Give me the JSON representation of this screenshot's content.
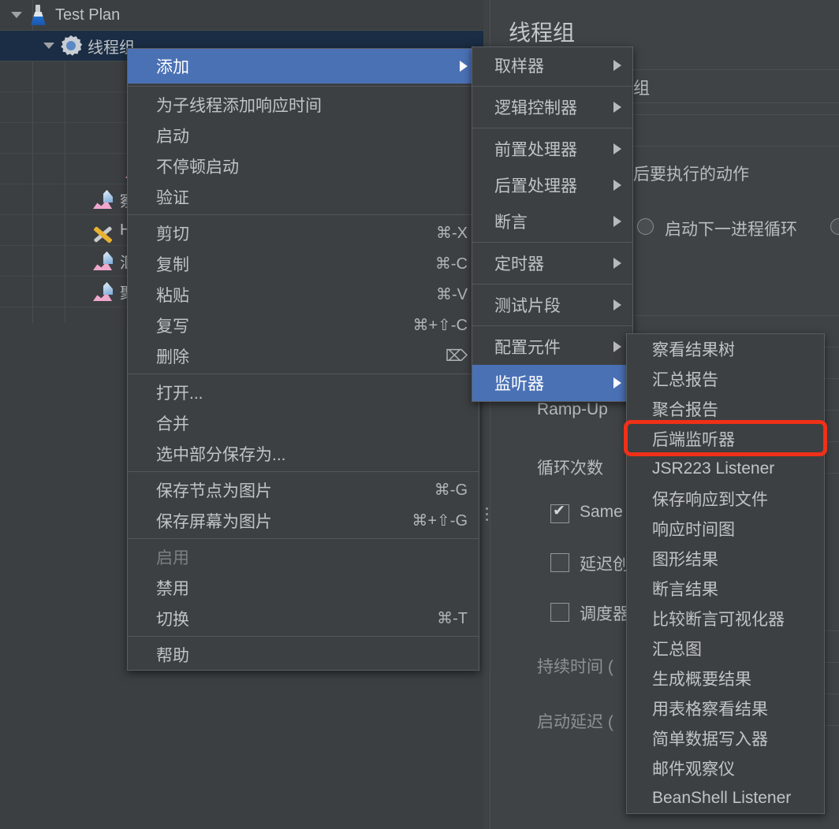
{
  "app": {
    "title": "线程组",
    "theme_bg": "#3c3f41",
    "menu_bg": "#3d4042",
    "highlight_blue": "#4b71b5",
    "selection_navy": "#1b2d44",
    "annotation_red": "#f03018"
  },
  "tree": {
    "items": [
      {
        "label": "Test Plan",
        "icon": "flask-icon",
        "depth": 0,
        "expanded": true,
        "selected": false
      },
      {
        "label": "线程组",
        "icon": "gear-icon",
        "depth": 1,
        "expanded": true,
        "selected": true
      },
      {
        "label": "",
        "icon": "pipette-green-icon",
        "depth": 3,
        "expanded": false,
        "selected": false
      },
      {
        "label": "",
        "icon": "pipette-gray-icon",
        "depth": 3,
        "expanded": false,
        "selected": false
      },
      {
        "label": "",
        "icon": "pipette-gray-icon",
        "depth": 3,
        "expanded": false,
        "selected": false
      },
      {
        "label": "",
        "icon": "chart-icon",
        "depth": 3,
        "expanded": false,
        "selected": false
      },
      {
        "label": "察看",
        "icon": "chart-icon",
        "depth": 2,
        "expanded": false,
        "selected": false
      },
      {
        "label": "HT",
        "icon": "tools-icon",
        "depth": 2,
        "expanded": false,
        "selected": false
      },
      {
        "label": "汇总",
        "icon": "chart-icon",
        "depth": 2,
        "expanded": false,
        "selected": false
      },
      {
        "label": "聚合",
        "icon": "chart-icon",
        "depth": 2,
        "expanded": false,
        "selected": false
      }
    ]
  },
  "form": {
    "title": "线程组",
    "name_fragment": "组",
    "action_label": "后要执行的动作",
    "radio_label": "启动下一进程循环",
    "ramp_up_label": "Ramp-Up",
    "loop_count_label": "循环次数",
    "same_user_label": "Same",
    "delay_create_label": "延迟创",
    "scheduler_label": "调度器",
    "duration_label": "持续时间 (",
    "startup_delay_label": "启动延迟 ("
  },
  "menu_context": {
    "items": [
      {
        "label": "添加",
        "accel": "",
        "submenu": true,
        "highlight": true,
        "disabled": false,
        "sep_after": true
      },
      {
        "label": "为子线程添加响应时间",
        "accel": "",
        "submenu": false,
        "highlight": false,
        "disabled": false,
        "sep_after": false
      },
      {
        "label": "启动",
        "accel": "",
        "submenu": false,
        "highlight": false,
        "disabled": false,
        "sep_after": false
      },
      {
        "label": "不停顿启动",
        "accel": "",
        "submenu": false,
        "highlight": false,
        "disabled": false,
        "sep_after": false
      },
      {
        "label": "验证",
        "accel": "",
        "submenu": false,
        "highlight": false,
        "disabled": false,
        "sep_after": true
      },
      {
        "label": "剪切",
        "accel": "⌘-X",
        "submenu": false,
        "highlight": false,
        "disabled": false,
        "sep_after": false
      },
      {
        "label": "复制",
        "accel": "⌘-C",
        "submenu": false,
        "highlight": false,
        "disabled": false,
        "sep_after": false
      },
      {
        "label": "粘贴",
        "accel": "⌘-V",
        "submenu": false,
        "highlight": false,
        "disabled": false,
        "sep_after": false
      },
      {
        "label": "复写",
        "accel": "⌘+⇧-C",
        "submenu": false,
        "highlight": false,
        "disabled": false,
        "sep_after": false
      },
      {
        "label": "删除",
        "accel": "⌦",
        "submenu": false,
        "highlight": false,
        "disabled": false,
        "sep_after": true
      },
      {
        "label": "打开...",
        "accel": "",
        "submenu": false,
        "highlight": false,
        "disabled": false,
        "sep_after": false
      },
      {
        "label": "合并",
        "accel": "",
        "submenu": false,
        "highlight": false,
        "disabled": false,
        "sep_after": false
      },
      {
        "label": "选中部分保存为...",
        "accel": "",
        "submenu": false,
        "highlight": false,
        "disabled": false,
        "sep_after": true
      },
      {
        "label": "保存节点为图片",
        "accel": "⌘-G",
        "submenu": false,
        "highlight": false,
        "disabled": false,
        "sep_after": false
      },
      {
        "label": "保存屏幕为图片",
        "accel": "⌘+⇧-G",
        "submenu": false,
        "highlight": false,
        "disabled": false,
        "sep_after": true
      },
      {
        "label": "启用",
        "accel": "",
        "submenu": false,
        "highlight": false,
        "disabled": true,
        "sep_after": false
      },
      {
        "label": "禁用",
        "accel": "",
        "submenu": false,
        "highlight": false,
        "disabled": false,
        "sep_after": false
      },
      {
        "label": "切换",
        "accel": "⌘-T",
        "submenu": false,
        "highlight": false,
        "disabled": false,
        "sep_after": true
      },
      {
        "label": "帮助",
        "accel": "",
        "submenu": false,
        "highlight": false,
        "disabled": false,
        "sep_after": false
      }
    ]
  },
  "menu_add": {
    "items": [
      {
        "label": "取样器",
        "submenu": true,
        "highlight": false,
        "sep_after": true
      },
      {
        "label": "逻辑控制器",
        "submenu": true,
        "highlight": false,
        "sep_after": true
      },
      {
        "label": "前置处理器",
        "submenu": true,
        "highlight": false,
        "sep_after": false
      },
      {
        "label": "后置处理器",
        "submenu": true,
        "highlight": false,
        "sep_after": false
      },
      {
        "label": "断言",
        "submenu": true,
        "highlight": false,
        "sep_after": true
      },
      {
        "label": "定时器",
        "submenu": true,
        "highlight": false,
        "sep_after": true
      },
      {
        "label": "测试片段",
        "submenu": true,
        "highlight": false,
        "sep_after": true
      },
      {
        "label": "配置元件",
        "submenu": true,
        "highlight": false,
        "sep_after": false
      },
      {
        "label": "监听器",
        "submenu": true,
        "highlight": true,
        "sep_after": false
      }
    ]
  },
  "menu_listener": {
    "items": [
      {
        "label": "察看结果树",
        "annotated": false
      },
      {
        "label": "汇总报告",
        "annotated": false
      },
      {
        "label": "聚合报告",
        "annotated": false
      },
      {
        "label": "后端监听器",
        "annotated": true
      },
      {
        "label": "JSR223 Listener",
        "annotated": false
      },
      {
        "label": "保存响应到文件",
        "annotated": false
      },
      {
        "label": "响应时间图",
        "annotated": false
      },
      {
        "label": "图形结果",
        "annotated": false
      },
      {
        "label": "断言结果",
        "annotated": false
      },
      {
        "label": "比较断言可视化器",
        "annotated": false
      },
      {
        "label": "汇总图",
        "annotated": false
      },
      {
        "label": "生成概要结果",
        "annotated": false
      },
      {
        "label": "用表格察看结果",
        "annotated": false
      },
      {
        "label": "简单数据写入器",
        "annotated": false
      },
      {
        "label": "邮件观察仪",
        "annotated": false
      },
      {
        "label": "BeanShell Listener",
        "annotated": false
      }
    ]
  }
}
